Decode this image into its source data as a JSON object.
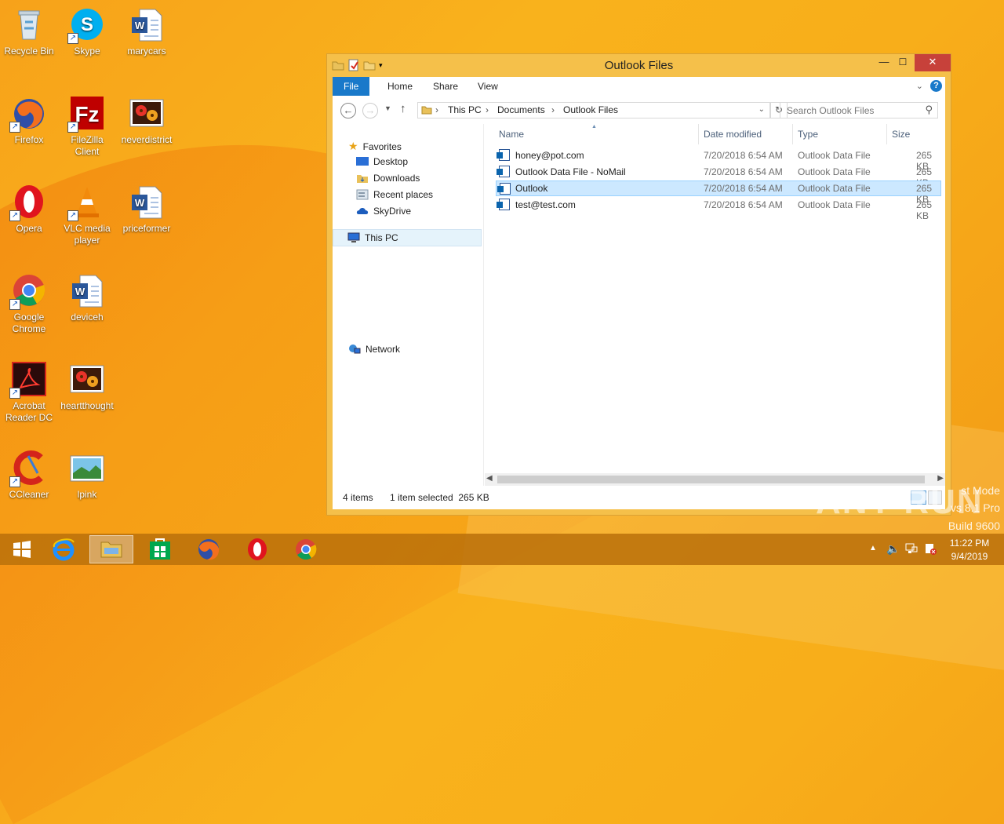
{
  "desktop": {
    "icons": [
      {
        "label": "Recycle Bin"
      },
      {
        "label": "Skype"
      },
      {
        "label": "marycars"
      },
      {
        "label": "Firefox"
      },
      {
        "label": "FileZilla Client"
      },
      {
        "label": "neverdistrict"
      },
      {
        "label": "Opera"
      },
      {
        "label": "VLC media player"
      },
      {
        "label": "priceformer"
      },
      {
        "label": "Google Chrome"
      },
      {
        "label": "deviceh"
      },
      {
        "label": "Acrobat Reader DC"
      },
      {
        "label": "heartthought"
      },
      {
        "label": "CCleaner"
      },
      {
        "label": "lpink"
      }
    ],
    "watermark": {
      "line1": "st Mode",
      "line2": "vs 8.1 Pro",
      "line3": "Build 9600"
    },
    "brand_text": "ANY RUN"
  },
  "window": {
    "title": "Outlook Files",
    "controls": {
      "minimize": "—",
      "maximize": "☐",
      "close": "✕"
    },
    "ribbon_tabs": [
      "File",
      "Home",
      "Share",
      "View"
    ],
    "address": {
      "crumbs": [
        "This PC",
        "Documents",
        "Outlook Files"
      ]
    },
    "search": {
      "placeholder": "Search Outlook Files"
    },
    "nav": {
      "favorites": "Favorites",
      "favorites_items": [
        "Desktop",
        "Downloads",
        "Recent places",
        "SkyDrive"
      ],
      "this_pc": "This PC",
      "network": "Network"
    },
    "columns": {
      "name": "Name",
      "date": "Date modified",
      "type": "Type",
      "size": "Size"
    },
    "files": [
      {
        "name": "honey@pot.com",
        "date": "7/20/2018 6:54 AM",
        "type": "Outlook Data File",
        "size": "265 KB"
      },
      {
        "name": "Outlook Data File - NoMail",
        "date": "7/20/2018 6:54 AM",
        "type": "Outlook Data File",
        "size": "265 KB"
      },
      {
        "name": "Outlook",
        "date": "7/20/2018 6:54 AM",
        "type": "Outlook Data File",
        "size": "265 KB"
      },
      {
        "name": "test@test.com",
        "date": "7/20/2018 6:54 AM",
        "type": "Outlook Data File",
        "size": "265 KB"
      }
    ],
    "status": {
      "count": "4 items",
      "selection": "1 item selected  265 KB"
    }
  },
  "taskbar": {
    "clock_time": "11:22 PM",
    "clock_date": "9/4/2019"
  },
  "colors": {
    "accent": "#1979ca",
    "selection": "#cce8ff",
    "close": "#c7413a"
  }
}
